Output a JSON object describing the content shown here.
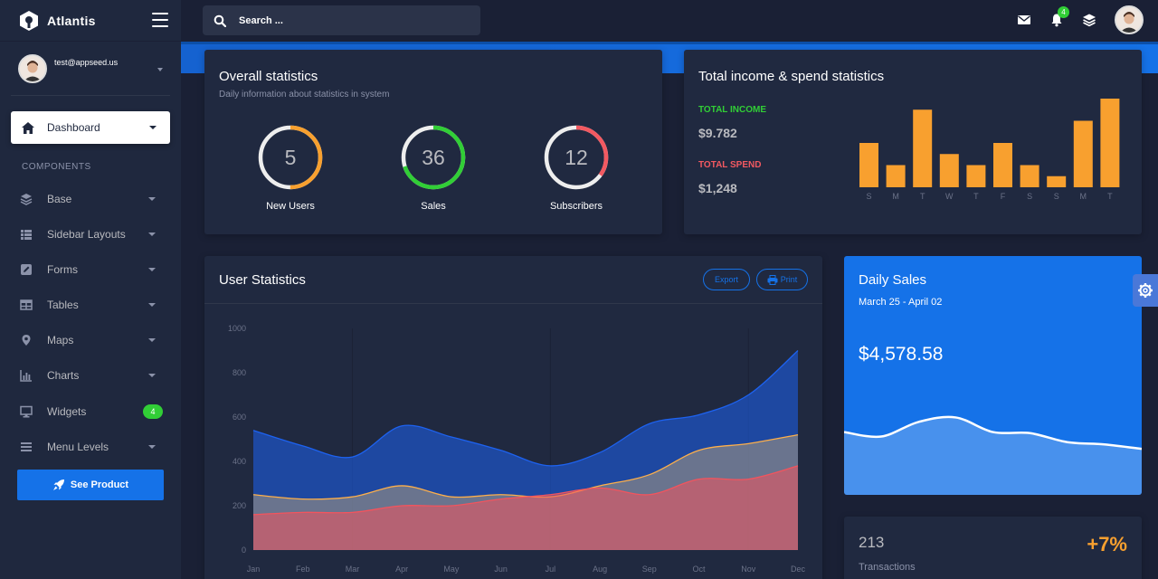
{
  "app": {
    "name": "Atlantis"
  },
  "user": {
    "email": "test@appseed.us"
  },
  "search": {
    "placeholder": "Search ..."
  },
  "notifications": {
    "count": "4"
  },
  "sidebar": {
    "active": {
      "label": "Dashboard"
    },
    "section_title": "COMPONENTS",
    "items": [
      {
        "label": "Base",
        "icon": "layers-icon"
      },
      {
        "label": "Sidebar Layouts",
        "icon": "list-icon"
      },
      {
        "label": "Forms",
        "icon": "pen-square-icon"
      },
      {
        "label": "Tables",
        "icon": "table-icon"
      },
      {
        "label": "Maps",
        "icon": "map-marker-icon"
      },
      {
        "label": "Charts",
        "icon": "bar-chart-icon"
      },
      {
        "label": "Widgets",
        "icon": "desktop-icon",
        "badge": "4"
      },
      {
        "label": "Menu Levels",
        "icon": "bars-icon"
      }
    ],
    "see_product_label": "See Product"
  },
  "overall": {
    "title": "Overall statistics",
    "subtitle": "Daily information about statistics in system",
    "rings": [
      {
        "value": "5",
        "label": "New Users",
        "percent": 0.5,
        "color": "#f8a02f"
      },
      {
        "value": "36",
        "label": "Sales",
        "percent": 0.7,
        "color": "#31ce36"
      },
      {
        "value": "12",
        "label": "Subscribers",
        "percent": 0.35,
        "color": "#f25961"
      }
    ]
  },
  "income": {
    "title": "Total income & spend statistics",
    "income_label": "TOTAL INCOME",
    "income_value": "$9.782",
    "spend_label": "TOTAL SPEND",
    "spend_value": "$1,248",
    "bar_color": "#f8a02f"
  },
  "user_stats": {
    "title": "User Statistics",
    "export_label": "Export",
    "print_label": "Print"
  },
  "daily_sales": {
    "title": "Daily Sales",
    "date_range": "March 25 - April 02",
    "amount": "$4,578.58"
  },
  "transactions": {
    "value": "213",
    "label": "Transactions",
    "change": "+7%"
  },
  "chart_data": [
    {
      "type": "bar",
      "categories": [
        "S",
        "M",
        "T",
        "W",
        "T",
        "F",
        "S",
        "S",
        "M",
        "T"
      ],
      "values": [
        8,
        4,
        14,
        6,
        4,
        8,
        4,
        2,
        12,
        16
      ],
      "ylim": [
        0,
        16
      ]
    },
    {
      "type": "area",
      "title": "User Statistics",
      "categories": [
        "Jan",
        "Feb",
        "Mar",
        "Apr",
        "May",
        "Jun",
        "Jul",
        "Aug",
        "Sep",
        "Oct",
        "Nov",
        "Dec"
      ],
      "ylim": [
        0,
        1000
      ],
      "yticks": [
        0,
        200,
        400,
        600,
        800,
        1000
      ],
      "series": [
        {
          "values": [
            540,
            470,
            420,
            560,
            510,
            450,
            380,
            440,
            570,
            610,
            700,
            900
          ],
          "color": "#1d62f0"
        },
        {
          "values": [
            250,
            230,
            240,
            290,
            240,
            250,
            240,
            290,
            340,
            450,
            480,
            520
          ],
          "color": "#fdaf4b"
        },
        {
          "values": [
            160,
            170,
            170,
            200,
            200,
            230,
            250,
            280,
            250,
            320,
            320,
            380
          ],
          "color": "#f3545d"
        }
      ]
    },
    {
      "type": "line",
      "title": "Daily Sales",
      "values": [
        56,
        52,
        65,
        69,
        56,
        55,
        47,
        45,
        41
      ],
      "ylim": [
        0,
        100
      ]
    }
  ]
}
